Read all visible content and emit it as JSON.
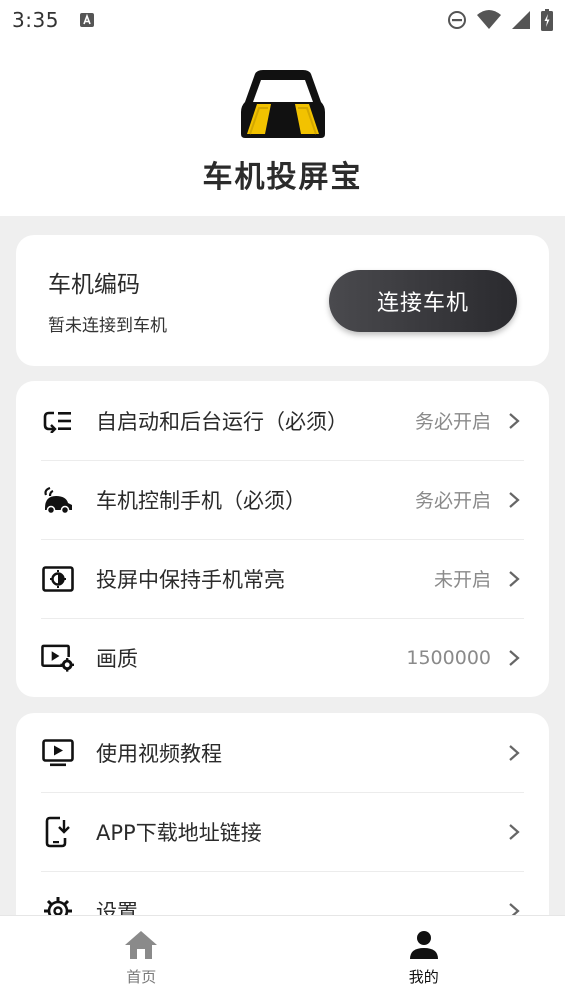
{
  "status_bar": {
    "time": "3:35",
    "icons": [
      "notification-a-icon",
      "do-not-disturb-icon",
      "wifi-icon",
      "signal-icon",
      "battery-icon"
    ]
  },
  "header": {
    "title": "车机投屏宝",
    "logo_colors": {
      "body": "#111111",
      "lights": "#f2c200"
    }
  },
  "connect": {
    "title": "车机编码",
    "status": "暂未连接到车机",
    "button_label": "连接车机"
  },
  "settings": [
    {
      "icon": "autostart-icon",
      "label": "自启动和后台运行（必须）",
      "value": "务必开启"
    },
    {
      "icon": "car-control-icon",
      "label": "车机控制手机（必须）",
      "value": "务必开启"
    },
    {
      "icon": "screen-brightness-icon",
      "label": "投屏中保持手机常亮",
      "value": "未开启"
    },
    {
      "icon": "video-quality-icon",
      "label": "画质",
      "value": "1500000"
    }
  ],
  "links": [
    {
      "icon": "video-tutorial-icon",
      "label": "使用视频教程"
    },
    {
      "icon": "download-phone-icon",
      "label": "APP下载地址链接"
    },
    {
      "icon": "settings-gear-icon",
      "label": "设置"
    }
  ],
  "nav": {
    "home_label": "首页",
    "mine_label": "我的",
    "active": "mine"
  },
  "colors": {
    "background": "#efefef",
    "card": "#ffffff",
    "button": "#2a2a2e",
    "secondary_text": "#8a8a8a"
  }
}
